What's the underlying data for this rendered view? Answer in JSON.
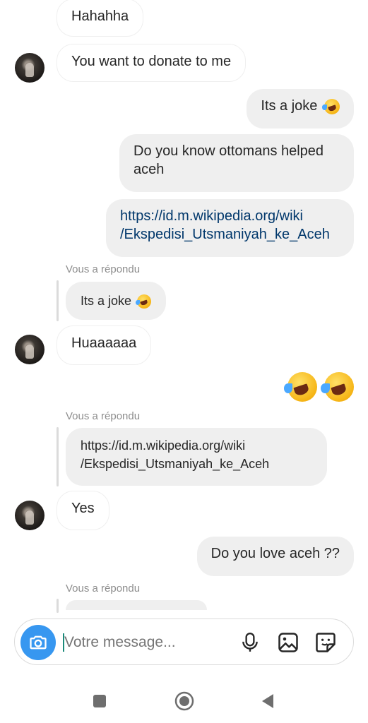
{
  "messages": {
    "m1": "Hahahha",
    "m2": "You want to donate to me",
    "m3": "Its a joke",
    "m4": "Do you know ottomans helped aceh",
    "m5_line1": "https://id.m.wikipedia.org/wiki",
    "m5_line2": "/Ekspedisi_Utsmaniyah_ke_Aceh",
    "m6": "Huaaaaaa",
    "m7": "Yes",
    "m8": "Do you love aceh ??"
  },
  "replies": {
    "label": "Vous a répondu",
    "r1": "Its a joke",
    "r2_line1": "https://id.m.wikipedia.org/wiki",
    "r2_line2": "/Ekspedisi_Utsmaniyah_ke_Aceh"
  },
  "composer": {
    "placeholder": "Votre message...",
    "camera_icon": "camera-icon",
    "mic_icon": "microphone-icon",
    "gallery_icon": "gallery-icon",
    "sticker_icon": "sticker-icon"
  },
  "navbar": {
    "recents_icon": "recents-icon",
    "home_icon": "home-icon",
    "back_icon": "back-icon"
  },
  "colors": {
    "accent": "#3797f0",
    "link": "#00376b",
    "outgoing_bubble": "#efefef",
    "meta_text": "#8e8e8e"
  }
}
